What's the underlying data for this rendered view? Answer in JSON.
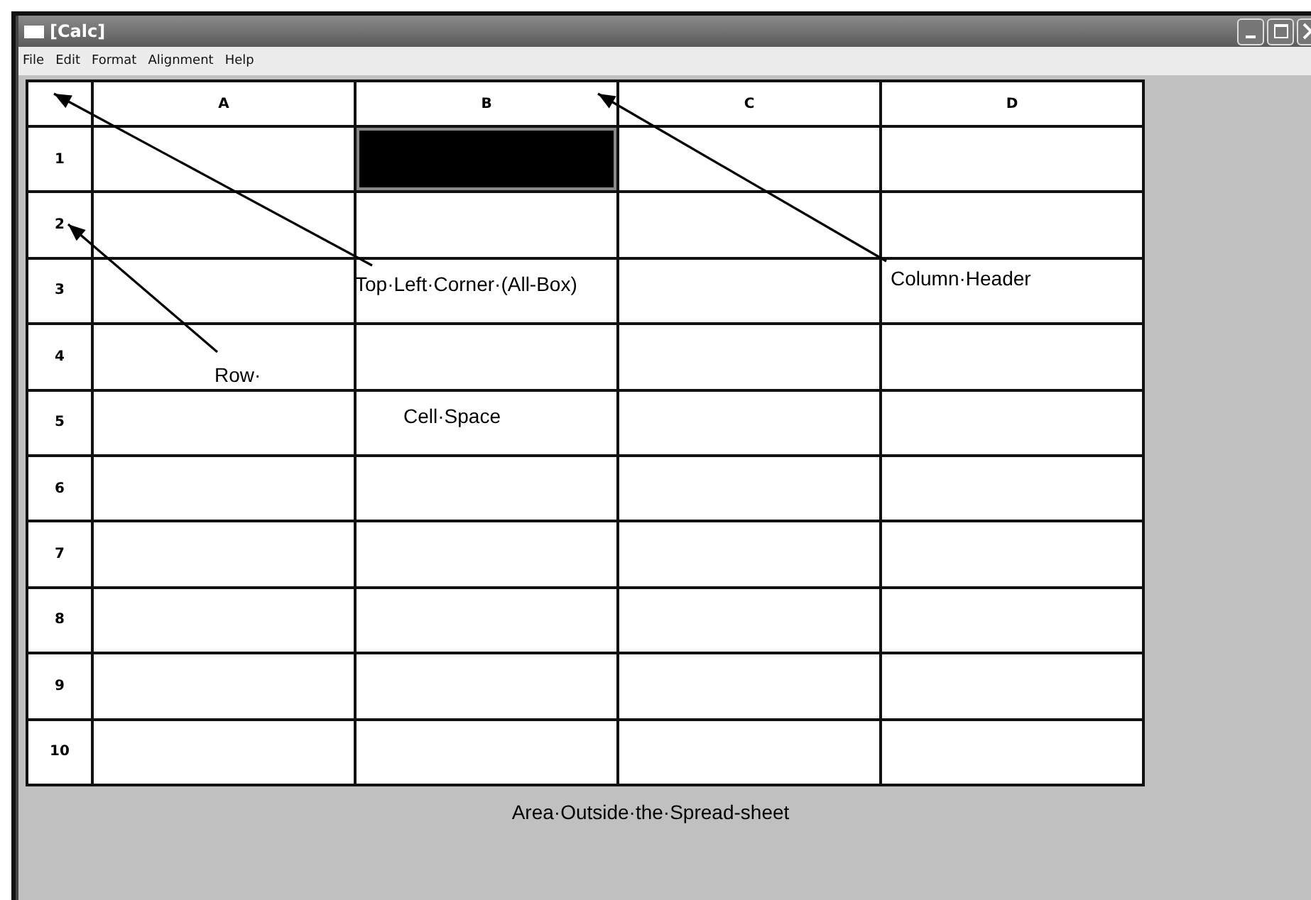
{
  "window": {
    "title": "[Calc]"
  },
  "menu": [
    {
      "label": "File"
    },
    {
      "label": "Edit"
    },
    {
      "label": "Format"
    },
    {
      "label": "Alignment"
    },
    {
      "label": "Help"
    }
  ],
  "sheet": {
    "columns": [
      "A",
      "B",
      "C",
      "D"
    ],
    "rows": [
      {
        "header": "1",
        "cells": [
          {
            "selected": false
          },
          {
            "selected": true
          },
          {
            "selected": false
          },
          {
            "selected": false
          }
        ]
      },
      {
        "header": "2",
        "cells": [
          {
            "selected": false
          },
          {
            "selected": false
          },
          {
            "selected": false
          },
          {
            "selected": false
          }
        ]
      },
      {
        "header": "3",
        "cells": [
          {
            "selected": false
          },
          {
            "selected": false
          },
          {
            "selected": false
          },
          {
            "selected": false
          }
        ]
      },
      {
        "header": "4",
        "cells": [
          {
            "selected": false
          },
          {
            "selected": false
          },
          {
            "selected": false
          },
          {
            "selected": false
          }
        ]
      },
      {
        "header": "5",
        "cells": [
          {
            "selected": false
          },
          {
            "selected": false
          },
          {
            "selected": false
          },
          {
            "selected": false
          }
        ]
      },
      {
        "header": "6",
        "cells": [
          {
            "selected": false
          },
          {
            "selected": false
          },
          {
            "selected": false
          },
          {
            "selected": false
          }
        ]
      },
      {
        "header": "7",
        "cells": [
          {
            "selected": false
          },
          {
            "selected": false
          },
          {
            "selected": false
          },
          {
            "selected": false
          }
        ]
      },
      {
        "header": "8",
        "cells": [
          {
            "selected": false
          },
          {
            "selected": false
          },
          {
            "selected": false
          },
          {
            "selected": false
          }
        ]
      },
      {
        "header": "9",
        "cells": [
          {
            "selected": false
          },
          {
            "selected": false
          },
          {
            "selected": false
          },
          {
            "selected": false
          }
        ]
      },
      {
        "header": "10",
        "cells": [
          {
            "selected": false
          },
          {
            "selected": false
          },
          {
            "selected": false
          },
          {
            "selected": false
          }
        ]
      }
    ]
  },
  "annotations": [
    {
      "text": "Top·Left·Corner·(All-Box)",
      "kind": "arrow"
    },
    {
      "text": "Column·Header",
      "kind": "arrow"
    },
    {
      "text": "Row·",
      "kind": "arrow"
    },
    {
      "text": "Cell·Space",
      "kind": "plain"
    }
  ],
  "outside_area": {
    "label": "Area·Outside·the·Spread-sheet"
  }
}
